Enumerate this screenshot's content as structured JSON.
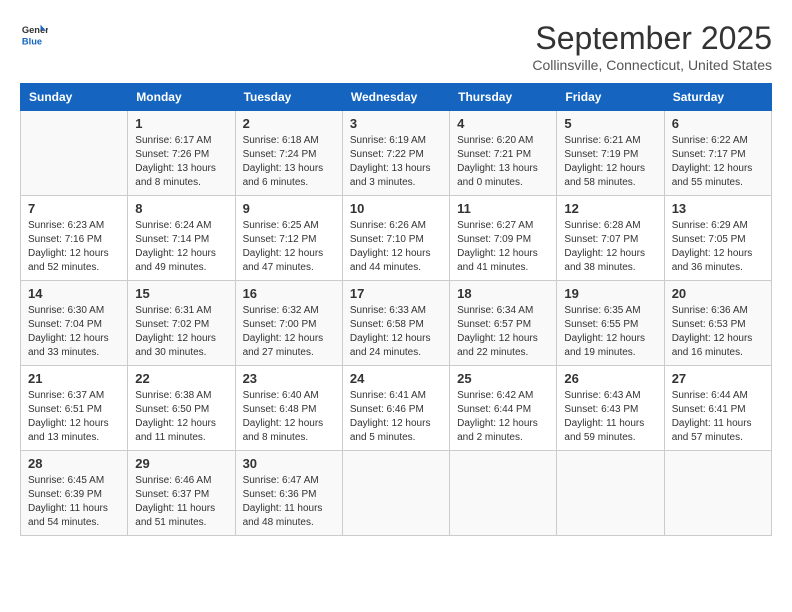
{
  "header": {
    "logo_general": "General",
    "logo_blue": "Blue",
    "title": "September 2025",
    "subtitle": "Collinsville, Connecticut, United States"
  },
  "weekdays": [
    "Sunday",
    "Monday",
    "Tuesday",
    "Wednesday",
    "Thursday",
    "Friday",
    "Saturday"
  ],
  "weeks": [
    [
      {
        "day": "",
        "sunrise": "",
        "sunset": "",
        "daylight": ""
      },
      {
        "day": "1",
        "sunrise": "Sunrise: 6:17 AM",
        "sunset": "Sunset: 7:26 PM",
        "daylight": "Daylight: 13 hours and 8 minutes."
      },
      {
        "day": "2",
        "sunrise": "Sunrise: 6:18 AM",
        "sunset": "Sunset: 7:24 PM",
        "daylight": "Daylight: 13 hours and 6 minutes."
      },
      {
        "day": "3",
        "sunrise": "Sunrise: 6:19 AM",
        "sunset": "Sunset: 7:22 PM",
        "daylight": "Daylight: 13 hours and 3 minutes."
      },
      {
        "day": "4",
        "sunrise": "Sunrise: 6:20 AM",
        "sunset": "Sunset: 7:21 PM",
        "daylight": "Daylight: 13 hours and 0 minutes."
      },
      {
        "day": "5",
        "sunrise": "Sunrise: 6:21 AM",
        "sunset": "Sunset: 7:19 PM",
        "daylight": "Daylight: 12 hours and 58 minutes."
      },
      {
        "day": "6",
        "sunrise": "Sunrise: 6:22 AM",
        "sunset": "Sunset: 7:17 PM",
        "daylight": "Daylight: 12 hours and 55 minutes."
      }
    ],
    [
      {
        "day": "7",
        "sunrise": "Sunrise: 6:23 AM",
        "sunset": "Sunset: 7:16 PM",
        "daylight": "Daylight: 12 hours and 52 minutes."
      },
      {
        "day": "8",
        "sunrise": "Sunrise: 6:24 AM",
        "sunset": "Sunset: 7:14 PM",
        "daylight": "Daylight: 12 hours and 49 minutes."
      },
      {
        "day": "9",
        "sunrise": "Sunrise: 6:25 AM",
        "sunset": "Sunset: 7:12 PM",
        "daylight": "Daylight: 12 hours and 47 minutes."
      },
      {
        "day": "10",
        "sunrise": "Sunrise: 6:26 AM",
        "sunset": "Sunset: 7:10 PM",
        "daylight": "Daylight: 12 hours and 44 minutes."
      },
      {
        "day": "11",
        "sunrise": "Sunrise: 6:27 AM",
        "sunset": "Sunset: 7:09 PM",
        "daylight": "Daylight: 12 hours and 41 minutes."
      },
      {
        "day": "12",
        "sunrise": "Sunrise: 6:28 AM",
        "sunset": "Sunset: 7:07 PM",
        "daylight": "Daylight: 12 hours and 38 minutes."
      },
      {
        "day": "13",
        "sunrise": "Sunrise: 6:29 AM",
        "sunset": "Sunset: 7:05 PM",
        "daylight": "Daylight: 12 hours and 36 minutes."
      }
    ],
    [
      {
        "day": "14",
        "sunrise": "Sunrise: 6:30 AM",
        "sunset": "Sunset: 7:04 PM",
        "daylight": "Daylight: 12 hours and 33 minutes."
      },
      {
        "day": "15",
        "sunrise": "Sunrise: 6:31 AM",
        "sunset": "Sunset: 7:02 PM",
        "daylight": "Daylight: 12 hours and 30 minutes."
      },
      {
        "day": "16",
        "sunrise": "Sunrise: 6:32 AM",
        "sunset": "Sunset: 7:00 PM",
        "daylight": "Daylight: 12 hours and 27 minutes."
      },
      {
        "day": "17",
        "sunrise": "Sunrise: 6:33 AM",
        "sunset": "Sunset: 6:58 PM",
        "daylight": "Daylight: 12 hours and 24 minutes."
      },
      {
        "day": "18",
        "sunrise": "Sunrise: 6:34 AM",
        "sunset": "Sunset: 6:57 PM",
        "daylight": "Daylight: 12 hours and 22 minutes."
      },
      {
        "day": "19",
        "sunrise": "Sunrise: 6:35 AM",
        "sunset": "Sunset: 6:55 PM",
        "daylight": "Daylight: 12 hours and 19 minutes."
      },
      {
        "day": "20",
        "sunrise": "Sunrise: 6:36 AM",
        "sunset": "Sunset: 6:53 PM",
        "daylight": "Daylight: 12 hours and 16 minutes."
      }
    ],
    [
      {
        "day": "21",
        "sunrise": "Sunrise: 6:37 AM",
        "sunset": "Sunset: 6:51 PM",
        "daylight": "Daylight: 12 hours and 13 minutes."
      },
      {
        "day": "22",
        "sunrise": "Sunrise: 6:38 AM",
        "sunset": "Sunset: 6:50 PM",
        "daylight": "Daylight: 12 hours and 11 minutes."
      },
      {
        "day": "23",
        "sunrise": "Sunrise: 6:40 AM",
        "sunset": "Sunset: 6:48 PM",
        "daylight": "Daylight: 12 hours and 8 minutes."
      },
      {
        "day": "24",
        "sunrise": "Sunrise: 6:41 AM",
        "sunset": "Sunset: 6:46 PM",
        "daylight": "Daylight: 12 hours and 5 minutes."
      },
      {
        "day": "25",
        "sunrise": "Sunrise: 6:42 AM",
        "sunset": "Sunset: 6:44 PM",
        "daylight": "Daylight: 12 hours and 2 minutes."
      },
      {
        "day": "26",
        "sunrise": "Sunrise: 6:43 AM",
        "sunset": "Sunset: 6:43 PM",
        "daylight": "Daylight: 11 hours and 59 minutes."
      },
      {
        "day": "27",
        "sunrise": "Sunrise: 6:44 AM",
        "sunset": "Sunset: 6:41 PM",
        "daylight": "Daylight: 11 hours and 57 minutes."
      }
    ],
    [
      {
        "day": "28",
        "sunrise": "Sunrise: 6:45 AM",
        "sunset": "Sunset: 6:39 PM",
        "daylight": "Daylight: 11 hours and 54 minutes."
      },
      {
        "day": "29",
        "sunrise": "Sunrise: 6:46 AM",
        "sunset": "Sunset: 6:37 PM",
        "daylight": "Daylight: 11 hours and 51 minutes."
      },
      {
        "day": "30",
        "sunrise": "Sunrise: 6:47 AM",
        "sunset": "Sunset: 6:36 PM",
        "daylight": "Daylight: 11 hours and 48 minutes."
      },
      {
        "day": "",
        "sunrise": "",
        "sunset": "",
        "daylight": ""
      },
      {
        "day": "",
        "sunrise": "",
        "sunset": "",
        "daylight": ""
      },
      {
        "day": "",
        "sunrise": "",
        "sunset": "",
        "daylight": ""
      },
      {
        "day": "",
        "sunrise": "",
        "sunset": "",
        "daylight": ""
      }
    ]
  ]
}
